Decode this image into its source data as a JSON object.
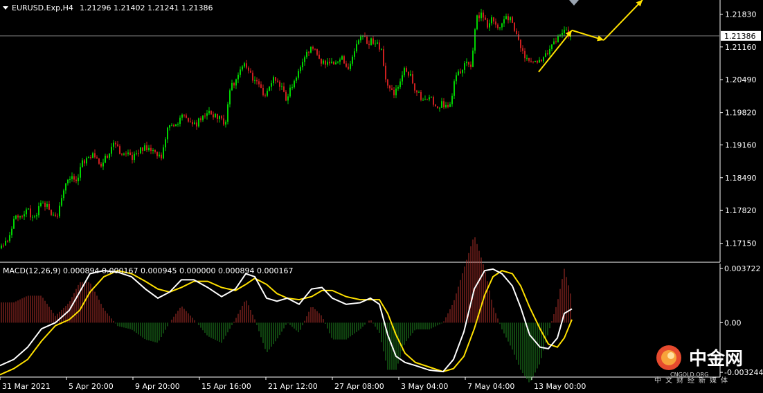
{
  "header": {
    "symbol_label": "EURUSD.Exp,H4",
    "ohlc_label": "1.21296 1.21402 1.21241 1.21386"
  },
  "macd_header": "MACD(12,26,9) 0.000894 0.000167 0.000945 0.000000 0.000894 0.000167",
  "colors": {
    "bull": "#00d400",
    "bear": "#cc1f1f",
    "hist_pos": "#b0302a",
    "hist_neg": "#1f8a1f",
    "macd_line": "#ffffff",
    "signal_line": "#ffe100",
    "arrow": "#ffe100",
    "axis": "#ffffff",
    "price_line": "#808080",
    "background": "#000000"
  },
  "chart_data": [
    {
      "type": "candlestick",
      "title": "EURUSD.Exp,H4",
      "current_price": 1.21386,
      "ylim": [
        1.1682,
        1.2209
      ],
      "y_ticks": [
        1.2183,
        1.2116,
        1.2049,
        1.1982,
        1.1916,
        1.1849,
        1.1782,
        1.1715
      ],
      "price_path": [
        [
          0,
          1.1705
        ],
        [
          14,
          1.1735
        ],
        [
          22,
          1.1778
        ],
        [
          28,
          1.1765
        ],
        [
          40,
          1.1782
        ],
        [
          48,
          1.176
        ],
        [
          60,
          1.1803
        ],
        [
          70,
          1.1782
        ],
        [
          82,
          1.1772
        ],
        [
          92,
          1.1832
        ],
        [
          102,
          1.1848
        ],
        [
          110,
          1.1838
        ],
        [
          118,
          1.188
        ],
        [
          126,
          1.1888
        ],
        [
          134,
          1.1902
        ],
        [
          145,
          1.1876
        ],
        [
          155,
          1.1896
        ],
        [
          162,
          1.1918
        ],
        [
          172,
          1.1902
        ],
        [
          182,
          1.19
        ],
        [
          192,
          1.189
        ],
        [
          202,
          1.1905
        ],
        [
          212,
          1.1912
        ],
        [
          222,
          1.1898
        ],
        [
          232,
          1.189
        ],
        [
          240,
          1.1944
        ],
        [
          252,
          1.196
        ],
        [
          262,
          1.1975
        ],
        [
          272,
          1.1968
        ],
        [
          282,
          1.1958
        ],
        [
          292,
          1.1974
        ],
        [
          302,
          1.198
        ],
        [
          312,
          1.1976
        ],
        [
          324,
          1.1955
        ],
        [
          332,
          1.2035
        ],
        [
          342,
          1.205
        ],
        [
          352,
          1.2083
        ],
        [
          362,
          1.2058
        ],
        [
          372,
          1.2036
        ],
        [
          382,
          1.2018
        ],
        [
          392,
          1.205
        ],
        [
          402,
          1.204
        ],
        [
          412,
          1.2012
        ],
        [
          422,
          1.2038
        ],
        [
          432,
          1.2072
        ],
        [
          442,
          1.21
        ],
        [
          452,
          1.2118
        ],
        [
          462,
          1.2088
        ],
        [
          472,
          1.208
        ],
        [
          482,
          1.2088
        ],
        [
          492,
          1.2095
        ],
        [
          502,
          1.2075
        ],
        [
          512,
          1.211
        ],
        [
          520,
          1.2142
        ],
        [
          530,
          1.2125
        ],
        [
          540,
          1.2128
        ],
        [
          550,
          1.211
        ],
        [
          558,
          1.2035
        ],
        [
          566,
          1.2022
        ],
        [
          574,
          1.203
        ],
        [
          582,
          1.2068
        ],
        [
          592,
          1.206
        ],
        [
          600,
          1.2022
        ],
        [
          610,
          1.201
        ],
        [
          620,
          1.202
        ],
        [
          628,
          1.1995
        ],
        [
          638,
          1.2
        ],
        [
          648,
          1.1995
        ],
        [
          656,
          1.205
        ],
        [
          664,
          1.2068
        ],
        [
          672,
          1.208
        ],
        [
          680,
          1.2072
        ],
        [
          686,
          1.2175
        ],
        [
          694,
          1.218
        ],
        [
          702,
          1.216
        ],
        [
          710,
          1.2172
        ],
        [
          718,
          1.215
        ],
        [
          726,
          1.2168
        ],
        [
          734,
          1.2178
        ],
        [
          742,
          1.2155
        ],
        [
          748,
          1.2135
        ],
        [
          756,
          1.209
        ],
        [
          764,
          1.2085
        ],
        [
          772,
          1.209
        ],
        [
          780,
          1.2092
        ],
        [
          790,
          1.2108
        ],
        [
          800,
          1.2128
        ],
        [
          808,
          1.2146
        ],
        [
          816,
          1.2148
        ],
        [
          824,
          1.2139
        ]
      ],
      "arrows": [
        {
          "from": [
            778,
            1.2065
          ],
          "to": [
            826,
            1.215
          ]
        },
        {
          "from": [
            826,
            1.215
          ],
          "to": [
            872,
            1.213
          ]
        },
        {
          "from": [
            872,
            1.213
          ],
          "to": [
            928,
            1.2212
          ]
        }
      ]
    },
    {
      "type": "line",
      "title": "MACD(12,26,9)",
      "ylim": [
        -0.00342,
        0.003722
      ],
      "y_ticks": [
        0.003722,
        0.0,
        -0.003244
      ],
      "y_tick_labels": [
        "0.003722",
        "0.00",
        "-0.003244"
      ],
      "series": [
        {
          "name": "",
          "role": "macd",
          "points": [
            [
              0,
              -0.0028
            ],
            [
              20,
              -0.0024
            ],
            [
              40,
              -0.0016
            ],
            [
              60,
              -0.0004
            ],
            [
              80,
              0.0
            ],
            [
              100,
              0.0008
            ],
            [
              115,
              0.002
            ],
            [
              130,
              0.0032
            ],
            [
              150,
              0.0034
            ],
            [
              170,
              0.0033
            ],
            [
              190,
              0.003
            ],
            [
              210,
              0.0022
            ],
            [
              228,
              0.0016
            ],
            [
              245,
              0.002
            ],
            [
              262,
              0.0028
            ],
            [
              280,
              0.0028
            ],
            [
              300,
              0.0023
            ],
            [
              320,
              0.0017
            ],
            [
              340,
              0.0022
            ],
            [
              355,
              0.0032
            ],
            [
              368,
              0.003
            ],
            [
              385,
              0.0016
            ],
            [
              400,
              0.0014
            ],
            [
              415,
              0.0016
            ],
            [
              432,
              0.0012
            ],
            [
              450,
              0.0022
            ],
            [
              465,
              0.0023
            ],
            [
              480,
              0.0016
            ],
            [
              500,
              0.0012
            ],
            [
              520,
              0.0013
            ],
            [
              535,
              0.0016
            ],
            [
              548,
              0.0012
            ],
            [
              560,
              -0.0008
            ],
            [
              572,
              -0.0022
            ],
            [
              585,
              -0.0026
            ],
            [
              600,
              -0.0028
            ],
            [
              620,
              -0.0031
            ],
            [
              640,
              -0.0032
            ],
            [
              655,
              -0.0024
            ],
            [
              670,
              -0.0006
            ],
            [
              685,
              0.0022
            ],
            [
              700,
              0.0034
            ],
            [
              712,
              0.0035
            ],
            [
              725,
              0.0032
            ],
            [
              740,
              0.0024
            ],
            [
              752,
              0.001
            ],
            [
              765,
              -0.0008
            ],
            [
              780,
              -0.0016
            ],
            [
              792,
              -0.0017
            ],
            [
              805,
              -0.001
            ],
            [
              815,
              0.0006
            ],
            [
              826,
              0.0009
            ]
          ]
        },
        {
          "name": "",
          "role": "signal",
          "points": [
            [
              0,
              -0.0034
            ],
            [
              20,
              -0.003
            ],
            [
              40,
              -0.0024
            ],
            [
              60,
              -0.0012
            ],
            [
              80,
              -0.0002
            ],
            [
              100,
              0.0002
            ],
            [
              115,
              0.0008
            ],
            [
              130,
              0.002
            ],
            [
              150,
              0.003
            ],
            [
              170,
              0.0034
            ],
            [
              190,
              0.0032
            ],
            [
              210,
              0.0027
            ],
            [
              228,
              0.0022
            ],
            [
              245,
              0.002
            ],
            [
              262,
              0.0023
            ],
            [
              280,
              0.0027
            ],
            [
              300,
              0.0027
            ],
            [
              320,
              0.0023
            ],
            [
              340,
              0.0021
            ],
            [
              355,
              0.0025
            ],
            [
              368,
              0.0029
            ],
            [
              385,
              0.0025
            ],
            [
              400,
              0.0019
            ],
            [
              415,
              0.0016
            ],
            [
              432,
              0.0015
            ],
            [
              450,
              0.0017
            ],
            [
              465,
              0.0021
            ],
            [
              480,
              0.0021
            ],
            [
              500,
              0.0017
            ],
            [
              520,
              0.0015
            ],
            [
              535,
              0.0015
            ],
            [
              548,
              0.0015
            ],
            [
              560,
              0.0006
            ],
            [
              572,
              -0.0008
            ],
            [
              585,
              -0.002
            ],
            [
              600,
              -0.0026
            ],
            [
              620,
              -0.0029
            ],
            [
              640,
              -0.0032
            ],
            [
              655,
              -0.003
            ],
            [
              670,
              -0.0022
            ],
            [
              685,
              -0.0004
            ],
            [
              700,
              0.0018
            ],
            [
              712,
              0.003
            ],
            [
              725,
              0.0034
            ],
            [
              740,
              0.0032
            ],
            [
              752,
              0.0024
            ],
            [
              765,
              0.001
            ],
            [
              780,
              -0.0004
            ],
            [
              792,
              -0.0014
            ],
            [
              805,
              -0.0016
            ],
            [
              815,
              -0.001
            ],
            [
              826,
              0.0002
            ]
          ]
        }
      ]
    }
  ],
  "time_axis": {
    "labels": [
      {
        "at": 0,
        "text": "31 Mar 2021"
      },
      {
        "at": 96,
        "text": "5 Apr 20:00"
      },
      {
        "at": 192,
        "text": "9 Apr 20:00"
      },
      {
        "at": 288,
        "text": "15 Apr 16:00"
      },
      {
        "at": 384,
        "text": "21 Apr 12:00"
      },
      {
        "at": 480,
        "text": "27 Apr 08:00"
      },
      {
        "at": 576,
        "text": "3 May 04:00"
      },
      {
        "at": 672,
        "text": "7 May 04:00"
      },
      {
        "at": 768,
        "text": "13 May 00:00"
      }
    ]
  },
  "watermark": {
    "cn": "中金网",
    "en": "CNGOLD.ORG",
    "sub": "中文财经新媒体"
  }
}
